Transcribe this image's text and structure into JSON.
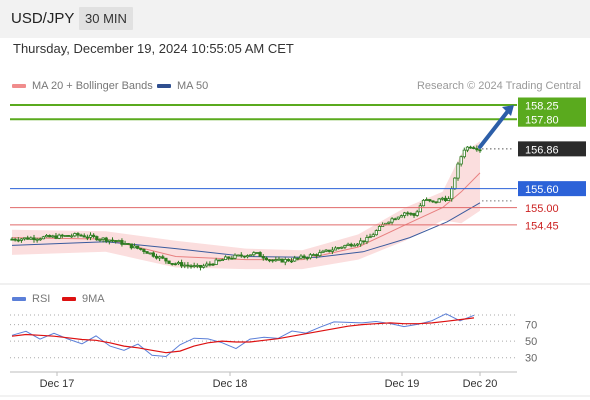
{
  "header": {
    "pair": "USD/JPY",
    "timeframe": "30 MIN",
    "timestamp": "Thursday, December 19, 2024 10:55:05 AM CET"
  },
  "legend": {
    "items": [
      {
        "label": "MA 20 + Bollinger Bands",
        "color": "#f08c8c"
      },
      {
        "label": "MA 50",
        "color": "#2f4f8f"
      }
    ],
    "credit": "Research © 2024 Trading Central"
  },
  "rsi_legend": {
    "items": [
      {
        "label": "RSI",
        "color": "#5b7fd8"
      },
      {
        "label": "9MA",
        "color": "#dd1111"
      }
    ]
  },
  "colors": {
    "resistance": "#5aaa1e",
    "pivot": "#2c62d8",
    "support": "#e06a6a",
    "support_label": "#cc2222",
    "current_label_bg": "#2b2b2b",
    "bb_fill": "#fbdede",
    "ma20": "#e88080",
    "ma50": "#3b5b9e",
    "candle": "#2c7a1e",
    "arrow": "#2c5ea8"
  },
  "chart_data": [
    {
      "type": "candlestick",
      "title": "USD/JPY",
      "timeframe": "30 MIN",
      "x_labels": [
        "Dec 17",
        "Dec 18",
        "Dec 19",
        "Dec 20"
      ],
      "levels": [
        {
          "value": 158.25,
          "label": "158.25",
          "kind": "resistance"
        },
        {
          "value": 157.8,
          "label": "157.80",
          "kind": "resistance"
        },
        {
          "value": 156.86,
          "label": "156.86",
          "kind": "current"
        },
        {
          "value": 155.6,
          "label": "155.60",
          "kind": "pivot"
        },
        {
          "value": 155.0,
          "label": "155.00",
          "kind": "support"
        },
        {
          "value": 154.45,
          "label": "154.45",
          "kind": "support"
        }
      ],
      "price_path": [
        {
          "x": 0,
          "y": 154.0
        },
        {
          "x": 0.1,
          "y": 154.08
        },
        {
          "x": 0.14,
          "y": 154.13
        },
        {
          "x": 0.22,
          "y": 153.95
        },
        {
          "x": 0.28,
          "y": 153.65
        },
        {
          "x": 0.34,
          "y": 153.25
        },
        {
          "x": 0.4,
          "y": 153.1
        },
        {
          "x": 0.46,
          "y": 153.4
        },
        {
          "x": 0.52,
          "y": 153.55
        },
        {
          "x": 0.56,
          "y": 153.3
        },
        {
          "x": 0.6,
          "y": 153.35
        },
        {
          "x": 0.66,
          "y": 153.55
        },
        {
          "x": 0.7,
          "y": 153.75
        },
        {
          "x": 0.74,
          "y": 153.9
        },
        {
          "x": 0.76,
          "y": 154.0
        },
        {
          "x": 0.8,
          "y": 154.55
        },
        {
          "x": 0.84,
          "y": 154.85
        },
        {
          "x": 0.86,
          "y": 154.75
        },
        {
          "x": 0.88,
          "y": 155.25
        },
        {
          "x": 0.9,
          "y": 155.15
        },
        {
          "x": 0.92,
          "y": 155.3
        },
        {
          "x": 0.935,
          "y": 155.25
        },
        {
          "x": 0.95,
          "y": 156.2
        },
        {
          "x": 0.965,
          "y": 156.85
        },
        {
          "x": 0.98,
          "y": 156.95
        },
        {
          "x": 1.0,
          "y": 156.86
        }
      ],
      "ma20": [
        {
          "x": 0,
          "y": 154.05
        },
        {
          "x": 0.2,
          "y": 154.0
        },
        {
          "x": 0.35,
          "y": 153.45
        },
        {
          "x": 0.5,
          "y": 153.35
        },
        {
          "x": 0.62,
          "y": 153.35
        },
        {
          "x": 0.74,
          "y": 153.75
        },
        {
          "x": 0.84,
          "y": 154.45
        },
        {
          "x": 0.92,
          "y": 155.0
        },
        {
          "x": 0.96,
          "y": 155.5
        },
        {
          "x": 1.0,
          "y": 156.1
        }
      ],
      "ma50": [
        {
          "x": 0,
          "y": 153.8
        },
        {
          "x": 0.2,
          "y": 153.92
        },
        {
          "x": 0.35,
          "y": 153.7
        },
        {
          "x": 0.5,
          "y": 153.45
        },
        {
          "x": 0.65,
          "y": 153.42
        },
        {
          "x": 0.75,
          "y": 153.6
        },
        {
          "x": 0.85,
          "y": 154.05
        },
        {
          "x": 0.93,
          "y": 154.55
        },
        {
          "x": 1.0,
          "y": 155.15
        }
      ],
      "bb_upper": [
        {
          "x": 0,
          "y": 154.3
        },
        {
          "x": 0.2,
          "y": 154.25
        },
        {
          "x": 0.35,
          "y": 153.95
        },
        {
          "x": 0.5,
          "y": 153.7
        },
        {
          "x": 0.62,
          "y": 153.65
        },
        {
          "x": 0.74,
          "y": 154.15
        },
        {
          "x": 0.84,
          "y": 155.0
        },
        {
          "x": 0.92,
          "y": 155.5
        },
        {
          "x": 0.96,
          "y": 156.7
        },
        {
          "x": 1.0,
          "y": 157.1
        }
      ],
      "bb_lower": [
        {
          "x": 0,
          "y": 153.5
        },
        {
          "x": 0.2,
          "y": 153.6
        },
        {
          "x": 0.35,
          "y": 153.1
        },
        {
          "x": 0.5,
          "y": 153.05
        },
        {
          "x": 0.62,
          "y": 153.05
        },
        {
          "x": 0.74,
          "y": 153.35
        },
        {
          "x": 0.84,
          "y": 153.95
        },
        {
          "x": 0.92,
          "y": 154.6
        },
        {
          "x": 0.96,
          "y": 154.5
        },
        {
          "x": 1.0,
          "y": 154.9
        }
      ],
      "projection_target": 158.25
    },
    {
      "type": "line",
      "series": [
        {
          "name": "RSI",
          "values": [
            57,
            60,
            55,
            58,
            52,
            49,
            54,
            45,
            40,
            44,
            35,
            31,
            44,
            56,
            51,
            48,
            43,
            50,
            56,
            54,
            60,
            62,
            66,
            72,
            75,
            70,
            74,
            73,
            65,
            72,
            75,
            81,
            77,
            80
          ]
        },
        {
          "name": "9MA",
          "values": [
            56,
            58,
            57,
            56,
            54,
            52,
            51,
            48,
            44,
            42,
            39,
            36,
            38,
            44,
            48,
            50,
            49,
            49,
            51,
            53,
            56,
            59,
            62,
            65,
            68,
            70,
            71,
            72,
            71,
            71,
            72,
            74,
            76,
            78
          ]
        }
      ],
      "y_ticks": [
        70,
        50,
        30
      ],
      "ylim": [
        20,
        90
      ]
    }
  ]
}
